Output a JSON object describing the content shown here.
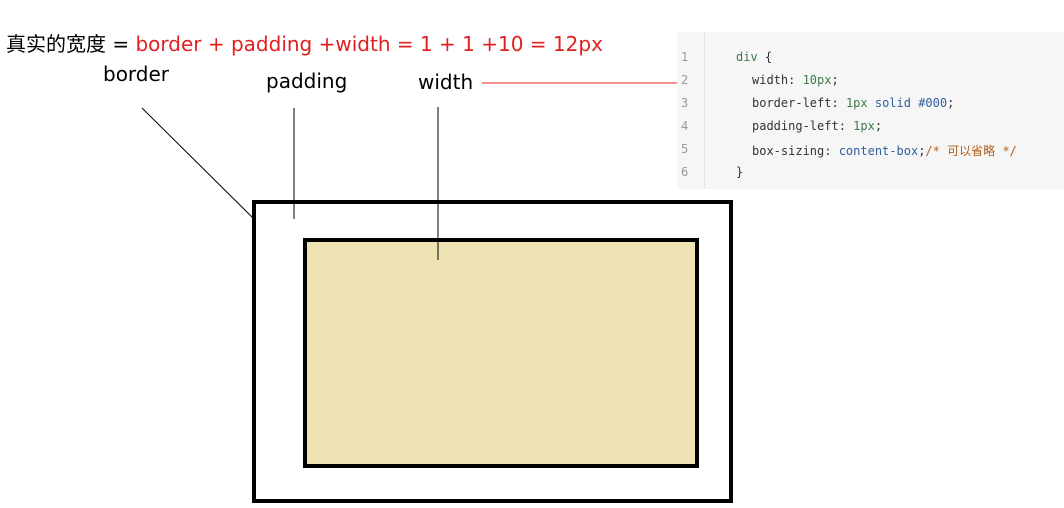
{
  "formula": {
    "lead": "真实的宽度 = ",
    "expr": "border + padding +width  =  1 + 1 +10 = 12px"
  },
  "labels": {
    "border": "border",
    "padding": "padding",
    "width": "width"
  },
  "code": {
    "line_numbers": [
      "1",
      "2",
      "3",
      "4",
      "5",
      "6"
    ],
    "l1_selector": "div",
    "l1_brace": " {",
    "l2_prop": "width",
    "l2_colon": ": ",
    "l2_val": "10px",
    "l2_semi": ";",
    "l3_prop": "border-left",
    "l3_colon": ": ",
    "l3_val1": "1px",
    "l3_val2": " solid ",
    "l3_val3": "#000",
    "l3_semi": ";",
    "l4_prop": "padding-left",
    "l4_colon": ": ",
    "l4_val": "1px",
    "l4_semi": ";",
    "l5_prop": "box-sizing",
    "l5_colon": ": ",
    "l5_val": "content-box",
    "l5_semi": ";",
    "l5_comment": "/* 可以省略 */",
    "l6_brace": "}"
  },
  "colors": {
    "content_fill": "#ede2b1",
    "accent_red": "#e02020",
    "border": "#000000"
  }
}
